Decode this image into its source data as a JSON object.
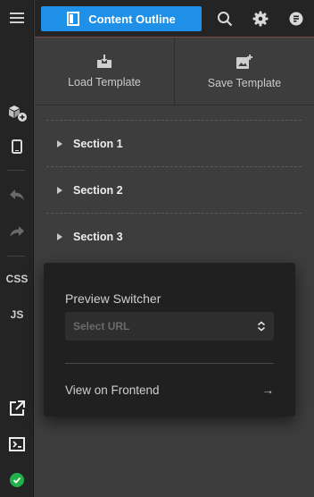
{
  "header": {
    "primary_button_label": "Content Outline"
  },
  "template_actions": {
    "load_label": "Load Template",
    "save_label": "Save Template"
  },
  "rail": {
    "css_label": "CSS",
    "js_label": "JS"
  },
  "sections": [
    {
      "label": "Section 1"
    },
    {
      "label": "Section 2"
    },
    {
      "label": "Section 3"
    }
  ],
  "preview_switcher": {
    "title": "Preview Switcher",
    "select_placeholder": "Select URL",
    "frontend_link": "View on Frontend",
    "arrow": "→"
  },
  "colors": {
    "accent": "#1e90e8",
    "status_ok": "#22b04b"
  }
}
